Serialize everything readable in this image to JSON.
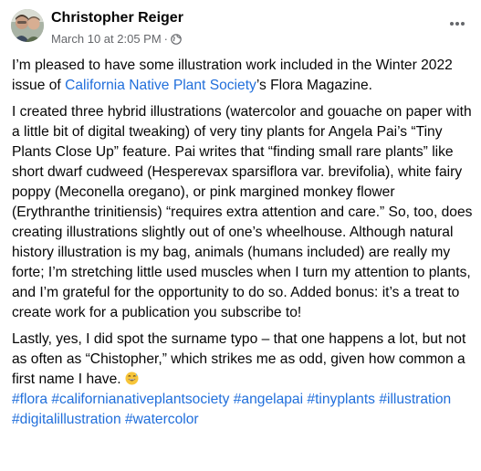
{
  "post": {
    "author": "Christopher Reiger",
    "timestamp": "March 10 at 2:05 PM",
    "separator": "·",
    "privacy_icon": "globe-icon",
    "more_icon": "more-horizontal-icon",
    "p1": {
      "before": "I’m pleased to have some illustration work included in the Winter 2022 issue of ",
      "link": "California Native Plant Society",
      "after": "’s Flora Magazine."
    },
    "p2": "I created three hybrid illustrations (watercolor and gouache on paper with a little bit of digital tweaking) of very tiny plants for Angela Pai’s “Tiny Plants Close Up” feature. Pai writes that “finding small rare plants” like short dwarf cudweed (Hesperevax sparsiflora var. brevifolia), white fairy poppy (Meconella oregano), or pink margined monkey flower (Erythranthe trinitiensis) “requires extra attention and care.” So, too, does creating illustrations slightly out of one’s wheelhouse. Although natural history illustration is my bag, animals (humans included) are really my forte; I’m stretching little used muscles when I turn my attention to plants, and I’m grateful for the opportunity to do so. Added bonus: it’s a treat to create work for a publication you subscribe to!",
    "p3": "Lastly, yes, I did spot the surname typo – that one happens a lot, but not as often as “Chistopher,” which strikes me as odd, given how common a first name I have.",
    "emoji_icon": "grinning-sweat-emoji-icon",
    "hashtags": [
      "#flora",
      "#californianativeplantsociety",
      "#angelapai",
      "#tinyplants",
      "#illustration",
      "#digitalillustration",
      "#watercolor"
    ],
    "colors": {
      "link": "#216fdb",
      "text": "#050505",
      "meta": "#65676b"
    }
  }
}
